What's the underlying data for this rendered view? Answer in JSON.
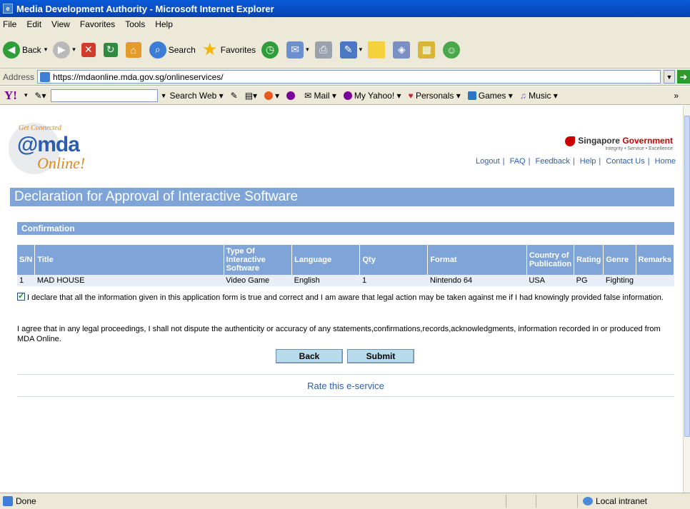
{
  "window": {
    "title": "Media Development Authority - Microsoft Internet Explorer"
  },
  "menu": [
    "File",
    "Edit",
    "View",
    "Favorites",
    "Tools",
    "Help"
  ],
  "toolbar": {
    "back": "Back",
    "search": "Search",
    "favorites": "Favorites"
  },
  "address": {
    "label": "Address",
    "url": "https://mdaonline.mda.gov.sg/onlineservices/"
  },
  "yahoo": {
    "search_web": "Search Web",
    "mail": "Mail",
    "my_yahoo": "My Yahoo!",
    "personals": "Personals",
    "games": "Games",
    "music": "Music"
  },
  "header": {
    "logo_get": "Get Connected",
    "logo_mda": "@mda",
    "logo_online": "Online!",
    "gov_name_1": "Singapore ",
    "gov_name_2": "Government",
    "gov_tag": "Integrity • Service • Excellence",
    "links": [
      "Logout",
      "FAQ",
      "Feedback",
      "Help",
      "Contact Us",
      "Home"
    ]
  },
  "page": {
    "title": "Declaration for Approval of Interactive Software",
    "section": "Confirmation"
  },
  "table": {
    "headers": [
      "S/N",
      "Title",
      "Type Of Interactive Software",
      "Language",
      "Qty",
      "Format",
      "Country of Publication",
      "Rating",
      "Genre",
      "Remarks"
    ],
    "rows": [
      {
        "sn": "1",
        "title": "MAD HOUSE",
        "type": "Video Game",
        "language": "English",
        "qty": "1",
        "format": "Nintendo 64",
        "country": "USA",
        "rating": "PG",
        "genre": "Fighting",
        "remarks": ""
      }
    ]
  },
  "declaration": {
    "checked": true,
    "text": "I declare that all the information given in this application form is true and correct and I am aware that legal action may be taken against me if I had knowingly provided false information.",
    "agree": "I agree that in any legal proceedings, I shall not dispute the authenticity or accuracy of any statements,confirmations,records,acknowledgments, information recorded in or produced from MDA Online."
  },
  "buttons": {
    "back": "Back",
    "submit": "Submit"
  },
  "rate": "Rate this e-service",
  "status": {
    "left": "Done",
    "zone": "Local intranet"
  }
}
